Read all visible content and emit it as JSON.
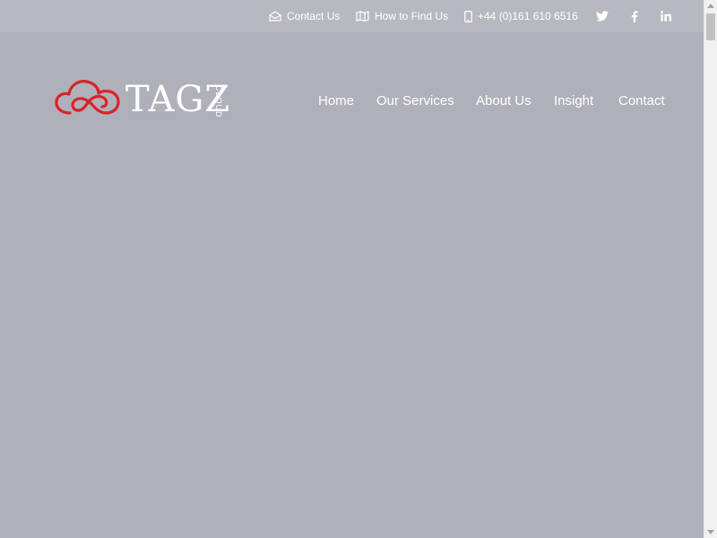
{
  "topbar": {
    "contact": "Contact Us",
    "find": "How to Find Us",
    "phone": "+44 (0)161 610 6516"
  },
  "logo": {
    "wordmark": "TAGZ",
    "sub": "CLOUD"
  },
  "nav": {
    "home": "Home",
    "services": "Our Services",
    "about": "About Us",
    "insight": "Insight",
    "contact": "Contact"
  },
  "colors": {
    "page_bg": "#b0b0ba",
    "logo_red": "#d8232a",
    "text": "#ffffff"
  }
}
